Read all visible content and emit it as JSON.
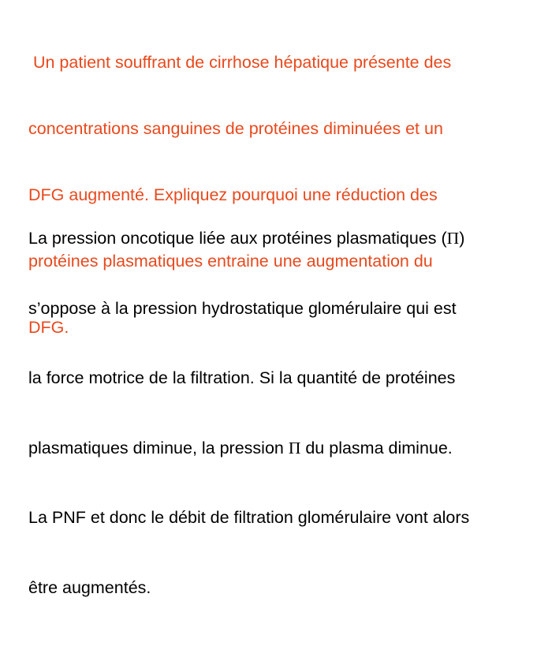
{
  "question": {
    "lines": [
      " Un patient souffrant de cirrhose hépatique présente des",
      "concentrations sanguines de protéines diminuées et un",
      "DFG augmenté. Expliquez pourquoi une réduction des",
      "protéines plasmatiques entraine une augmentation du",
      "DFG."
    ]
  },
  "answer": {
    "line1_a": "La pression oncotique liée aux protéines plasmatiques (",
    "line1_pi": "Π",
    "line1_b": ")",
    "line2": "s’oppose à la pression hydrostatique glomérulaire qui est",
    "line3": "la force motrice de la filtration. Si la quantité de protéines",
    "line4_a": "plasmatiques diminue, la pression ",
    "line4_pi": "Π",
    "line4_b": " du plasma diminue.",
    "line5": "La PNF et donc le débit de filtration glomérulaire vont alors",
    "line6": "être augmentés."
  },
  "colors": {
    "question_text": "#e8491d",
    "answer_text": "#000000",
    "background": "#ffffff"
  }
}
